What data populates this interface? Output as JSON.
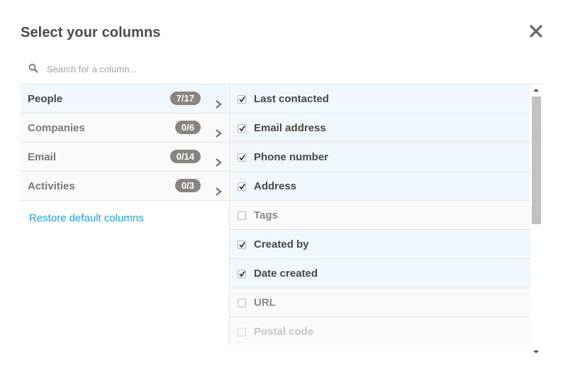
{
  "dialog": {
    "title": "Select your columns",
    "close_icon": "close-icon"
  },
  "search": {
    "placeholder": "Search for a column...",
    "value": "",
    "icon": "search-icon"
  },
  "categories": [
    {
      "label": "People",
      "badge": "7/17",
      "active": true,
      "icon": "chevron-right-icon"
    },
    {
      "label": "Companies",
      "badge": "0/6",
      "active": false,
      "icon": "chevron-right-icon"
    },
    {
      "label": "Email",
      "badge": "0/14",
      "active": false,
      "icon": "chevron-right-icon"
    },
    {
      "label": "Activities",
      "badge": "0/3",
      "active": false,
      "icon": "chevron-right-icon"
    }
  ],
  "restore_label": "Restore default columns",
  "columns": [
    {
      "label": "Last contacted",
      "checked": true
    },
    {
      "label": "Email address",
      "checked": true
    },
    {
      "label": "Phone number",
      "checked": true
    },
    {
      "label": "Address",
      "checked": true
    },
    {
      "label": "Tags",
      "checked": false
    },
    {
      "label": "Created by",
      "checked": true
    },
    {
      "label": "Date created",
      "checked": true
    },
    {
      "label": "URL",
      "checked": false
    },
    {
      "label": "Postal code",
      "checked": false
    }
  ],
  "colors": {
    "accent": "#229fd3",
    "badge_bg": "#8a847e",
    "active_row_bg": "#f0f8fd",
    "inactive_row_bg": "#fbfaf9"
  }
}
